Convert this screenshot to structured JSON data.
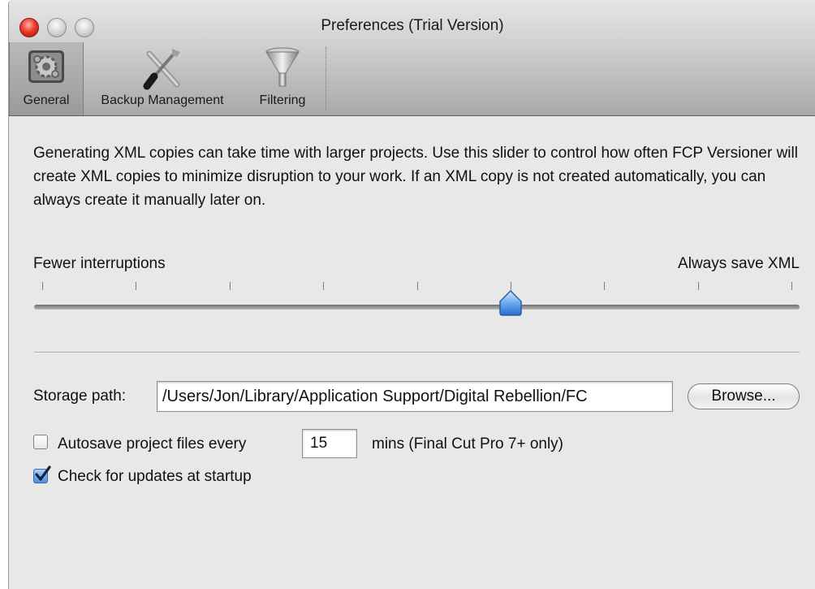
{
  "window": {
    "title": "Preferences (Trial Version)"
  },
  "toolbar": {
    "items": [
      {
        "label": "General",
        "icon": "gear-icon",
        "selected": true
      },
      {
        "label": "Backup Management",
        "icon": "tools-icon",
        "selected": false
      },
      {
        "label": "Filtering",
        "icon": "funnel-icon",
        "selected": false
      }
    ]
  },
  "general": {
    "description": "Generating XML copies can take time with larger projects. Use this slider to control how often FCP Versioner will create XML copies to minimize disruption to your work. If an XML copy is not created automatically, you can always create it manually later on.",
    "slider": {
      "min_label": "Fewer interruptions",
      "max_label": "Always save XML",
      "tick_count": 9,
      "value_fraction": 0.625
    },
    "storage": {
      "label": "Storage path:",
      "value": "/Users/Jon/Library/Application Support/Digital Rebellion/FC",
      "browse_label": "Browse..."
    },
    "autosave": {
      "checked": false,
      "label": "Autosave project files every",
      "minutes": "15",
      "suffix": "mins (Final Cut Pro 7+ only)"
    },
    "updates": {
      "checked": true,
      "label": "Check for updates at startup"
    }
  },
  "colors": {
    "selection_blue": "#4c8fe0",
    "close_red": "#ec3a2c"
  }
}
